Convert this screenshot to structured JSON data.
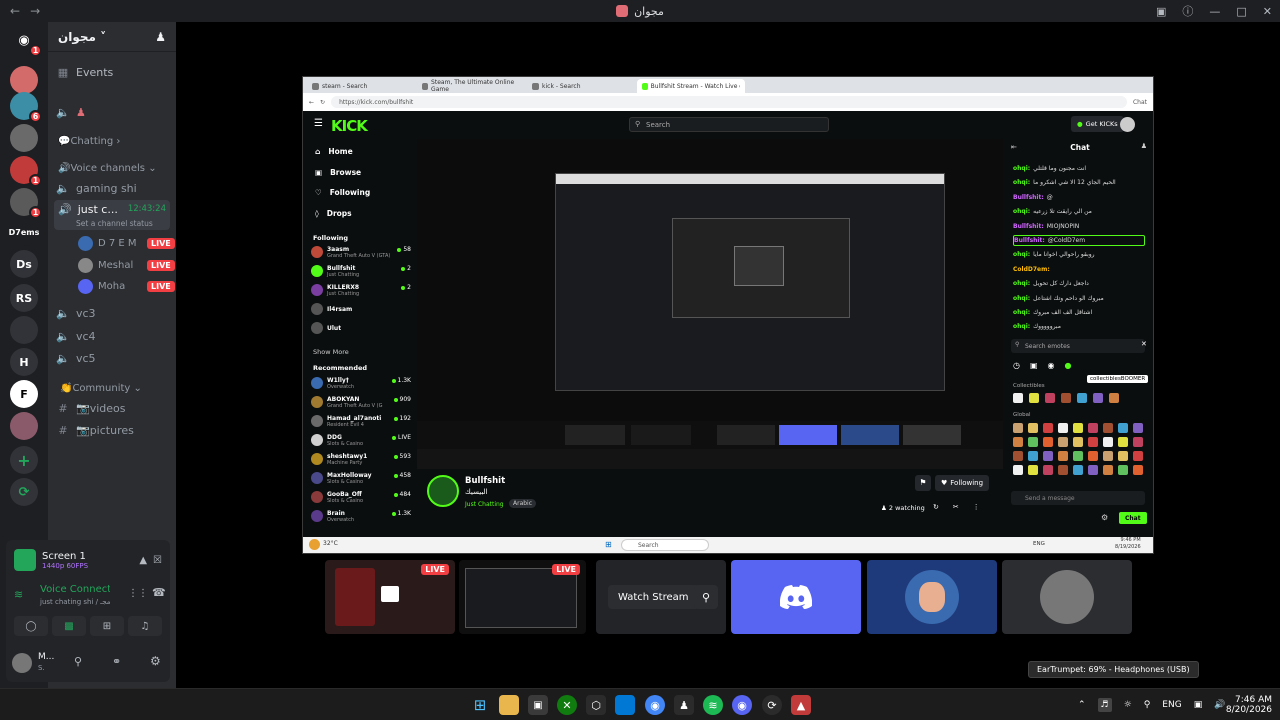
{
  "titlebar": {
    "server_name": "مجوان"
  },
  "rail": {
    "items": [
      {
        "label": "",
        "badge": "1",
        "color": "#5865f2"
      },
      {
        "label": "",
        "badge": "",
        "color": "#d36b6b"
      },
      {
        "label": "",
        "badge": "6",
        "color": "#3b8ea5"
      },
      {
        "label": "",
        "badge": "",
        "color": "#6a6a6a"
      },
      {
        "label": "",
        "badge": "1",
        "color": "#c23b3b"
      },
      {
        "label": "",
        "badge": "1",
        "color": "#5a5a5a"
      },
      {
        "label": "D7ems",
        "badge": "",
        "color": "#1e1f22"
      },
      {
        "label": "Ds",
        "badge": "",
        "color": "#313338"
      },
      {
        "label": "RS",
        "badge": "",
        "color": "#313338"
      },
      {
        "label": "",
        "badge": "",
        "color": "#313338"
      },
      {
        "label": "H",
        "badge": "",
        "color": "#313338"
      },
      {
        "label": "F",
        "badge": "",
        "color": "#ffffff"
      },
      {
        "label": "",
        "badge": "",
        "color": "#8a5a6a"
      }
    ]
  },
  "sidebar": {
    "server_title": "مجوان",
    "events_label": "Events",
    "channels": {
      "chatting_category": "💬Chatting",
      "voice_category": "🔊Voice channels",
      "gaming": "gaming shi",
      "active_channel": "just c...",
      "active_time": "12:43:24",
      "channel_status": "Set a channel status",
      "users": [
        {
          "name": "D 7 E M",
          "live": "LIVE"
        },
        {
          "name": "Meshal",
          "live": "LIVE"
        },
        {
          "name": "Moha",
          "live": "LIVE"
        }
      ],
      "vc3": "vc3",
      "vc4": "vc4",
      "vc5": "vc5",
      "community_category": "👏Community",
      "videos": "📷videos",
      "pictures": "📷pictures"
    }
  },
  "voice_panel": {
    "screen_title": "Screen 1",
    "screen_quality": "1440p 60FPS",
    "voice_status": "Voice Connected",
    "voice_sub": "just chating shi / مجـ",
    "user_name": "M...",
    "user_sub": "S."
  },
  "browser": {
    "tabs": [
      "steam - Search",
      "Steam, The Ultimate Online Game",
      "kick - Search",
      "Bullfshit Stream - Watch Live on Kick"
    ],
    "url": "https://kick.com/bullfshit",
    "chat_btn": "Chat",
    "kick": {
      "logo": "KICK",
      "search_placeholder": "Search",
      "get_kicks": "Get KICKs",
      "nav": [
        "Home",
        "Browse",
        "Following",
        "Drops"
      ],
      "following_heading": "Following",
      "following": [
        {
          "name": "3aasm",
          "game": "Grand Theft Auto V (GTA)",
          "viewers": "58",
          "color": "#c04a3a"
        },
        {
          "name": "Bullfshit",
          "game": "Just Chatting",
          "viewers": "2",
          "color": "#53fc18"
        },
        {
          "name": "KILLERX8",
          "game": "Just Chatting",
          "viewers": "2",
          "color": "#7a3ea0"
        },
        {
          "name": "Il4rsam",
          "game": "",
          "viewers": "",
          "color": "#555555"
        },
        {
          "name": "Ulut",
          "game": "",
          "viewers": "",
          "color": "#555555"
        }
      ],
      "show_more": "Show More",
      "recommended_heading": "Recommended",
      "recommended": [
        {
          "name": "W1lly†",
          "game": "Overwatch",
          "viewers": "1.3K",
          "color": "#3a6ab0"
        },
        {
          "name": "ABOKYAN",
          "game": "Grand Theft Auto V (G",
          "viewers": "909",
          "color": "#a07a30"
        },
        {
          "name": "Hamad_al7anoti",
          "game": "Resident Evil 4",
          "viewers": "192",
          "color": "#6a6a6a"
        },
        {
          "name": "DDG",
          "game": "Slots & Casino",
          "viewers": "LIVE",
          "color": "#d0d0d0"
        },
        {
          "name": "sheshtawy1",
          "game": "Machine Party",
          "viewers": "593",
          "color": "#b08a20"
        },
        {
          "name": "MaxHolloway",
          "game": "Slots & Casino",
          "viewers": "458",
          "color": "#4a4a8a"
        },
        {
          "name": "GooBa_Off",
          "game": "Slots & Casino",
          "viewers": "484",
          "color": "#8a3a3a"
        },
        {
          "name": "Brain",
          "game": "Overwatch",
          "viewers": "1.3K",
          "color": "#5a3a8a"
        }
      ],
      "streamer_name": "Bullfshit",
      "streamer_title": "البيسيك",
      "streamer_category": "Just Chatting",
      "streamer_tag": "Arabic",
      "watching": "2 watching",
      "following_btn": "Following",
      "chat_heading": "Chat",
      "chat": [
        {
          "user": "ohqi:",
          "msg": "انت مجنون وما قلتلي",
          "color": "#53fc18"
        },
        {
          "user": "ohqi:",
          "msg": "الحيم الجاي 12 الا شي اشكرو ما",
          "color": "#53fc18"
        },
        {
          "user": "Bullfshit:",
          "msg": "@",
          "color": "#d066ff"
        },
        {
          "user": "ohqi:",
          "msg": "من الي رايقت تلا زرعيه",
          "color": "#53fc18"
        },
        {
          "user": "Bullfshit:",
          "msg": "MIOJNOPIN",
          "color": "#d066ff"
        },
        {
          "user": "Bullfshit:",
          "msg": "@ColdD7em",
          "color": "#d066ff"
        },
        {
          "user": "ohqi:",
          "msg": "روبقو راحوالي اخوانا مايا",
          "color": "#53fc18"
        },
        {
          "user": "ColdD7em:",
          "msg": "",
          "color": "#ffbf00"
        },
        {
          "user": "ohqi:",
          "msg": "داجعل دارك كل تحويل",
          "color": "#53fc18"
        },
        {
          "user": "ohqi:",
          "msg": "مبروك الو داحم وتك اشتاعل",
          "color": "#53fc18"
        },
        {
          "user": "ohqi:",
          "msg": "اشتاقل الف الف مبروك",
          "color": "#53fc18"
        },
        {
          "user": "ohqi:",
          "msg": "مبروووووك",
          "color": "#53fc18"
        }
      ],
      "emote_search": "Search emotes",
      "emote_tooltip": "collectiblesBOOMER",
      "collectibles": "Collectibles",
      "global": "Global",
      "send_placeholder": "Send a message",
      "chat_send": "Chat"
    },
    "win_taskbar": {
      "search": "Search",
      "time": "9:46 PM",
      "date": "8/19/2026",
      "lang": "ENG",
      "temp": "32°C"
    }
  },
  "tiles": {
    "live_label": "LIVE",
    "watch_stream": "Watch Stream"
  },
  "taskbar": {
    "time": "7:46 AM",
    "date": "8/20/2026",
    "lang": "ENG",
    "tooltip": "EarTrumpet: 69% - Headphones (USB)"
  }
}
